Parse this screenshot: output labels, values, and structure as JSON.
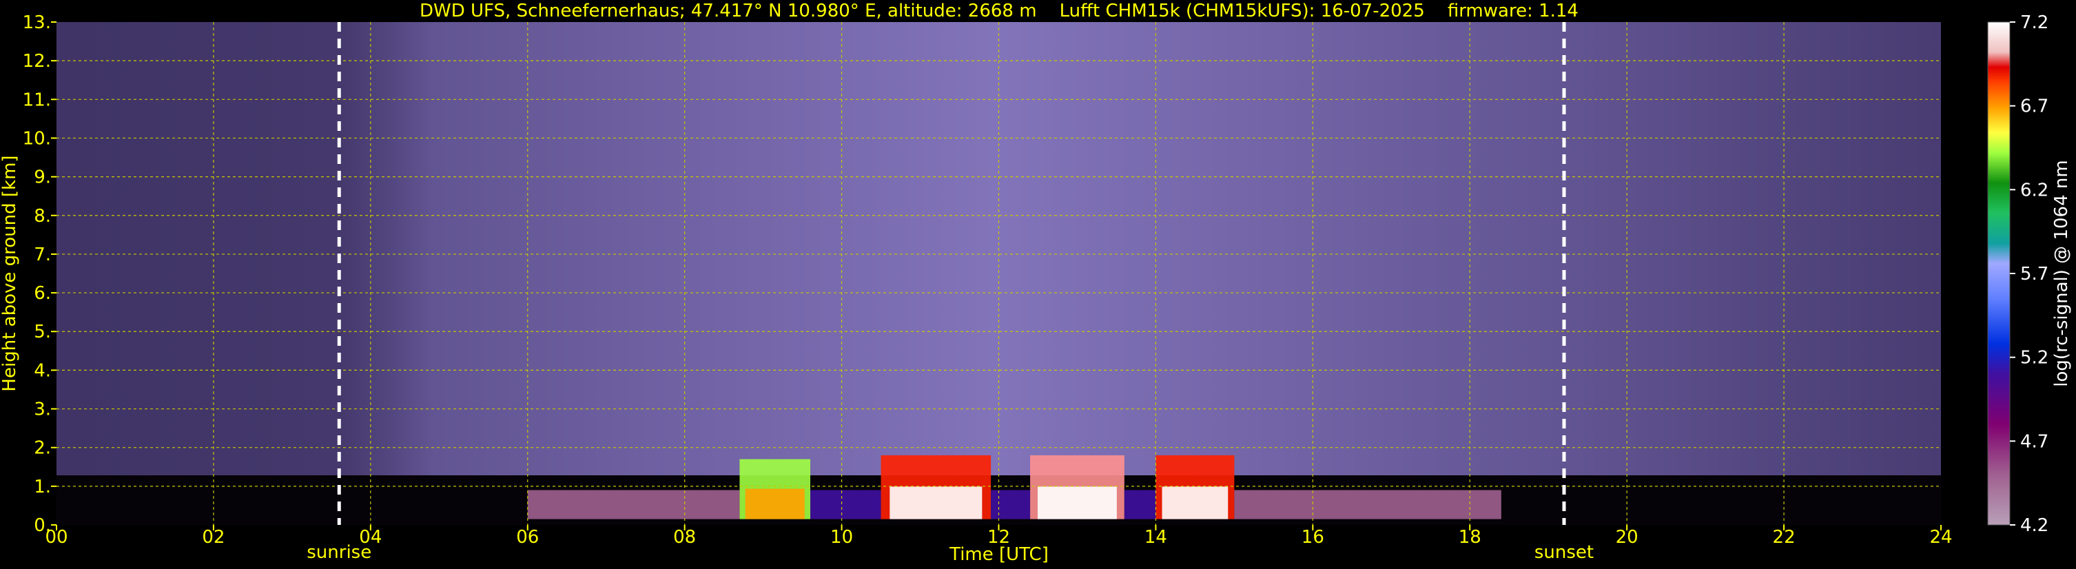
{
  "chart_data": {
    "type": "heatmap",
    "title": "DWD UFS, Schneefernerhaus; 47.417° N 10.980° E, altitude: 2668 m    Lufft CHM15k (CHM15kUFS): 16-07-2025    firmware: 1.14",
    "xlabel": "Time [UTC]",
    "ylabel": "Height above ground [km]",
    "xlim": [
      0,
      24
    ],
    "ylim": [
      0,
      13
    ],
    "x_ticks": [
      "00",
      "02",
      "04",
      "06",
      "08",
      "10",
      "12",
      "14",
      "16",
      "18",
      "20",
      "22",
      "24"
    ],
    "y_ticks": [
      "0.",
      "1.",
      "2.",
      "3.",
      "4.",
      "5.",
      "6.",
      "7.",
      "8.",
      "9.",
      "10.",
      "11.",
      "12.",
      "13."
    ],
    "grid": true,
    "colorbar": {
      "label": "log(rc-signal) @ 1064 nm",
      "range": [
        4.2,
        7.2
      ],
      "ticks": [
        "7.2",
        "6.7",
        "6.2",
        "5.7",
        "5.2",
        "4.7",
        "4.2"
      ]
    },
    "events": [
      {
        "name": "sunrise",
        "time": 3.6
      },
      {
        "name": "sunset",
        "time": 19.2
      }
    ],
    "boundary_layer_segments": [
      {
        "start": 6.0,
        "end": 8.7,
        "top_km": 0.9,
        "level": 4.5
      },
      {
        "start": 8.7,
        "end": 9.6,
        "top_km": 1.7,
        "level": 6.2
      },
      {
        "start": 9.6,
        "end": 10.5,
        "top_km": 0.9,
        "level": 5.2
      },
      {
        "start": 10.5,
        "end": 11.9,
        "top_km": 1.8,
        "level": 6.8
      },
      {
        "start": 11.9,
        "end": 12.4,
        "top_km": 0.9,
        "level": 5.2
      },
      {
        "start": 12.4,
        "end": 13.6,
        "top_km": 1.8,
        "level": 7.0
      },
      {
        "start": 13.6,
        "end": 14.0,
        "top_km": 0.9,
        "level": 5.2
      },
      {
        "start": 14.0,
        "end": 15.0,
        "top_km": 1.8,
        "level": 6.8
      },
      {
        "start": 15.0,
        "end": 18.4,
        "top_km": 0.9,
        "level": 4.7
      }
    ]
  }
}
